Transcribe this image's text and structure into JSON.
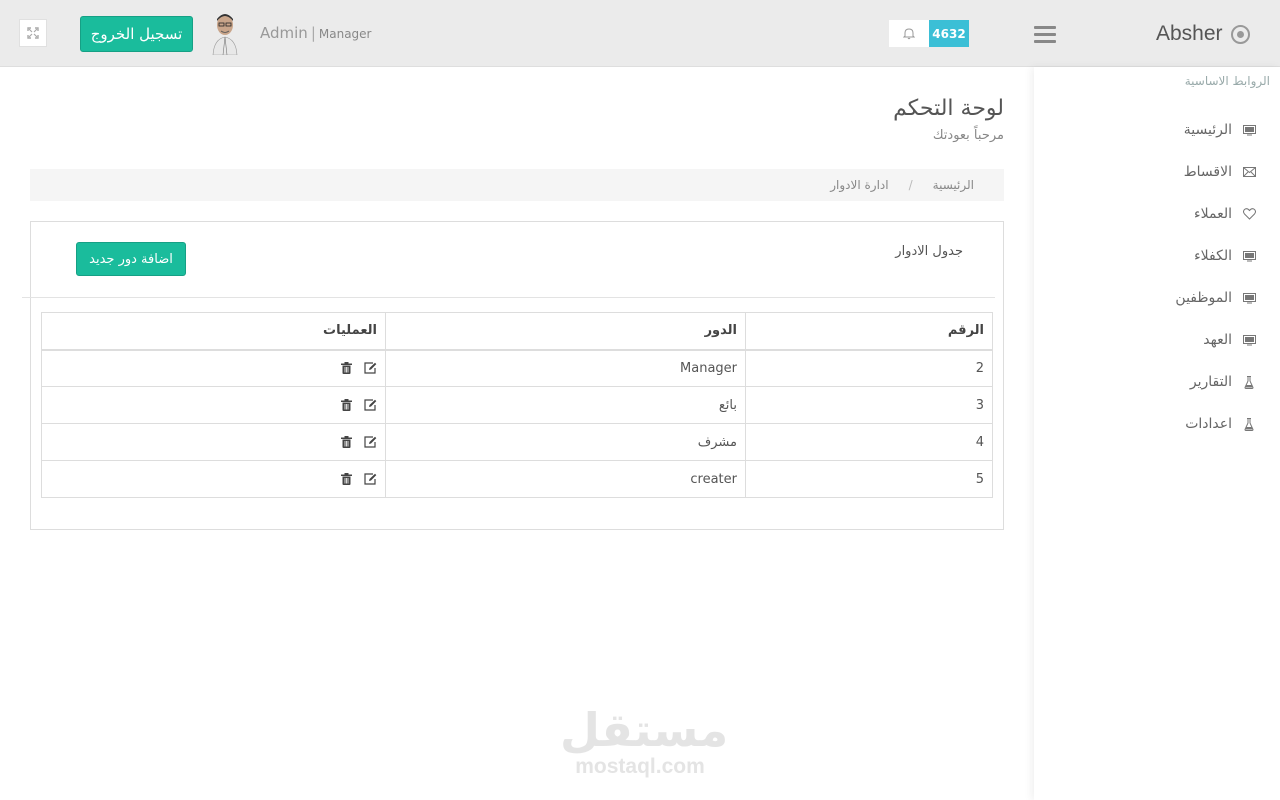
{
  "topbar": {
    "logout_label": "تسجيل الخروج",
    "user_name": "Admin",
    "user_separator": "|",
    "user_role": "Manager",
    "notification_count": "4632",
    "brand_name": "Absher"
  },
  "sidebar": {
    "heading": "الروابط الاساسية",
    "items": [
      {
        "label": "الرئيسية",
        "icon": "monitor-icon"
      },
      {
        "label": "الاقساط",
        "icon": "envelope-icon"
      },
      {
        "label": "العملاء",
        "icon": "heart-icon"
      },
      {
        "label": "الكفلاء",
        "icon": "monitor-icon"
      },
      {
        "label": "الموظفين",
        "icon": "monitor-icon"
      },
      {
        "label": "العهد",
        "icon": "monitor-icon"
      },
      {
        "label": "التقارير",
        "icon": "flask-icon"
      },
      {
        "label": "اعدادات",
        "icon": "flask-icon"
      }
    ]
  },
  "page": {
    "title": "لوحة التحكم",
    "subtitle": "مرحباً بعودتك"
  },
  "breadcrumb": {
    "home": "الرئيسية",
    "separator": "/",
    "current": "ادارة الادوار"
  },
  "panel": {
    "title": "جدول الادوار",
    "add_button_label": "اضافة دور جديد"
  },
  "table": {
    "headers": {
      "number": "الرقم",
      "role": "الدور",
      "operations": "العمليات"
    },
    "rows": [
      {
        "number": "2",
        "role": "Manager"
      },
      {
        "number": "3",
        "role": "بائع"
      },
      {
        "number": "4",
        "role": "مشرف"
      },
      {
        "number": "5",
        "role": "creater"
      }
    ]
  },
  "watermark": {
    "arabic": "مستقل",
    "latin": "mostaql.com"
  },
  "colors": {
    "accent": "#1abc9c",
    "badge": "#3bbfd6",
    "topbar": "#ebebeb"
  }
}
